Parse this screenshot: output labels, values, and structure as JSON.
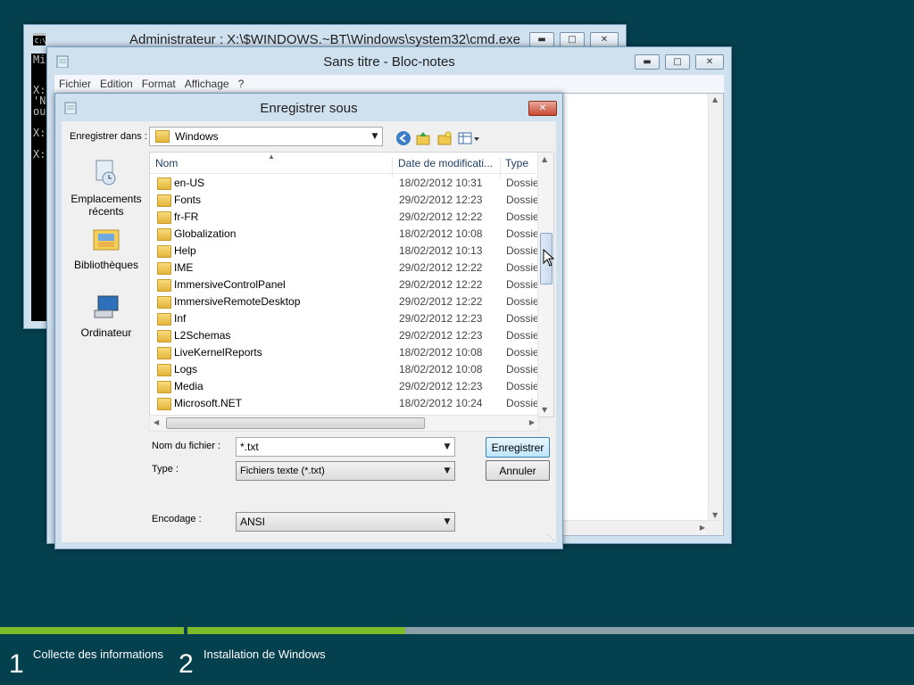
{
  "cmd": {
    "title": "Administrateur : X:\\$WINDOWS.~BT\\Windows\\system32\\cmd.exe",
    "lines": [
      "Mi",
      "",
      "X:",
      "'N",
      "ou",
      "",
      "X:",
      "",
      "X:"
    ]
  },
  "notepad": {
    "title": "Sans titre - Bloc-notes",
    "menu": [
      "Fichier",
      "Edition",
      "Format",
      "Affichage",
      "?"
    ]
  },
  "dialog": {
    "title": "Enregistrer sous",
    "save_in_label": "Enregistrer dans :",
    "save_in_value": "Windows",
    "places": [
      "Emplacements récents",
      "Bibliothèques",
      "Ordinateur"
    ],
    "columns": [
      "Nom",
      "Date de modificati...",
      "Type"
    ],
    "rows": [
      {
        "name": "en-US",
        "date": "18/02/2012 10:31",
        "type": "Dossie"
      },
      {
        "name": "Fonts",
        "date": "29/02/2012 12:23",
        "type": "Dossie"
      },
      {
        "name": "fr-FR",
        "date": "29/02/2012 12:22",
        "type": "Dossie"
      },
      {
        "name": "Globalization",
        "date": "18/02/2012 10:08",
        "type": "Dossie"
      },
      {
        "name": "Help",
        "date": "18/02/2012 10:13",
        "type": "Dossie"
      },
      {
        "name": "IME",
        "date": "29/02/2012 12:22",
        "type": "Dossie"
      },
      {
        "name": "ImmersiveControlPanel",
        "date": "29/02/2012 12:22",
        "type": "Dossie"
      },
      {
        "name": "ImmersiveRemoteDesktop",
        "date": "29/02/2012 12:22",
        "type": "Dossie"
      },
      {
        "name": "Inf",
        "date": "29/02/2012 12:23",
        "type": "Dossie"
      },
      {
        "name": "L2Schemas",
        "date": "29/02/2012 12:23",
        "type": "Dossie"
      },
      {
        "name": "LiveKernelReports",
        "date": "18/02/2012 10:08",
        "type": "Dossie"
      },
      {
        "name": "Logs",
        "date": "18/02/2012 10:08",
        "type": "Dossie"
      },
      {
        "name": "Media",
        "date": "29/02/2012 12:23",
        "type": "Dossie"
      },
      {
        "name": "Microsoft.NET",
        "date": "18/02/2012 10:24",
        "type": "Dossie"
      }
    ],
    "filename_label": "Nom du fichier :",
    "filename_value": "*.txt",
    "type_label": "Type :",
    "type_value": "Fichiers texte (*.txt)",
    "encoding_label": "Encodage :",
    "encoding_value": "ANSI",
    "save_button": "Enregistrer",
    "cancel_button": "Annuler"
  },
  "setup": {
    "steps": [
      {
        "num": "1",
        "label": "Collecte des informations"
      },
      {
        "num": "2",
        "label": "Installation de Windows"
      }
    ],
    "step1_progress": 1.0,
    "step2_progress": 0.3,
    "colors": {
      "background": "#05404f",
      "progress_fill": "#7dbb2a",
      "progress_track": "#8a9fa6"
    }
  }
}
